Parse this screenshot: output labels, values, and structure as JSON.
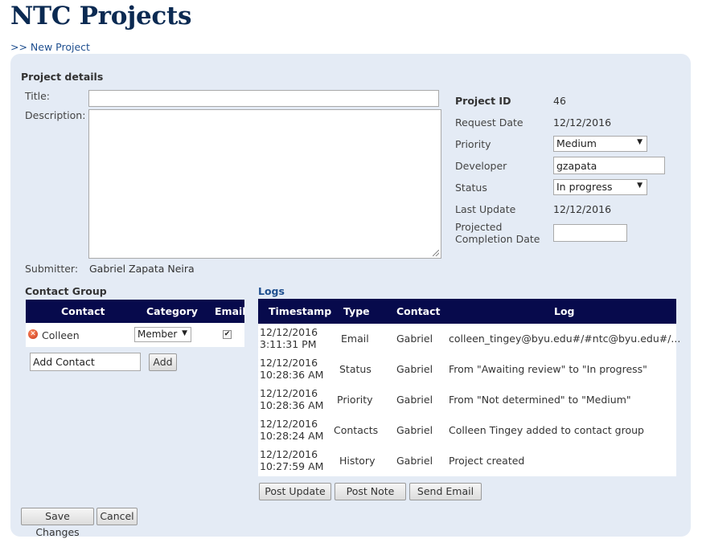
{
  "header": {
    "title": "NTC Projects",
    "new_project_link": ">> New Project"
  },
  "details": {
    "section_title": "Project details",
    "title_label": "Title:",
    "title_value": "",
    "description_label": "Description:",
    "description_value": "",
    "submitter_label": "Submitter:",
    "submitter_value": "Gabriel Zapata Neira"
  },
  "meta": {
    "project_id_label": "Project ID",
    "project_id_value": "46",
    "request_date_label": "Request Date",
    "request_date_value": "12/12/2016",
    "priority_label": "Priority",
    "priority_value": "Medium",
    "developer_label": "Developer",
    "developer_value": "gzapata",
    "status_label": "Status",
    "status_value": "In progress",
    "last_update_label": "Last Update",
    "last_update_value": "12/12/2016",
    "projected_label_line1": "Projected",
    "projected_label_line2": "Completion Date",
    "projected_value": ""
  },
  "contacts": {
    "section_title": "Contact Group",
    "columns": [
      "Contact",
      "Category",
      "Email"
    ],
    "rows": [
      {
        "name": "Colleen",
        "category": "Member",
        "email_checked": "✔",
        "remove_icon": "remove-icon"
      }
    ],
    "add_contact_value": "Add Contact",
    "add_button": "Add"
  },
  "logs": {
    "section_title": "Logs",
    "columns": [
      "Timestamp",
      "Type",
      "Contact",
      "Log"
    ],
    "rows": [
      {
        "date": "12/12/2016",
        "time": "3:11:31 PM",
        "type": "Email",
        "contact": "Gabriel",
        "log": "colleen_tingey@byu.edu#/#ntc@byu.edu#/..."
      },
      {
        "date": "12/12/2016",
        "time": "10:28:36 AM",
        "type": "Status",
        "contact": "Gabriel",
        "log": "From \"Awaiting review\" to \"In progress\""
      },
      {
        "date": "12/12/2016",
        "time": "10:28:36 AM",
        "type": "Priority",
        "contact": "Gabriel",
        "log": "From \"Not determined\" to \"Medium\""
      },
      {
        "date": "12/12/2016",
        "time": "10:28:24 AM",
        "type": "Contacts",
        "contact": "Gabriel",
        "log": "Colleen Tingey added to contact group"
      },
      {
        "date": "12/12/2016",
        "time": "10:27:59 AM",
        "type": "History",
        "contact": "Gabriel",
        "log": "Project created"
      }
    ],
    "buttons": [
      "Post Update",
      "Post Note",
      "Send Email"
    ]
  },
  "footer": {
    "save_button": "Save Changes",
    "cancel_button": "Cancel"
  },
  "colors": {
    "title": "#0b2a52",
    "panel_bg": "#e4ebf5",
    "table_header": "#070a4c",
    "link": "#1f4f8f"
  }
}
